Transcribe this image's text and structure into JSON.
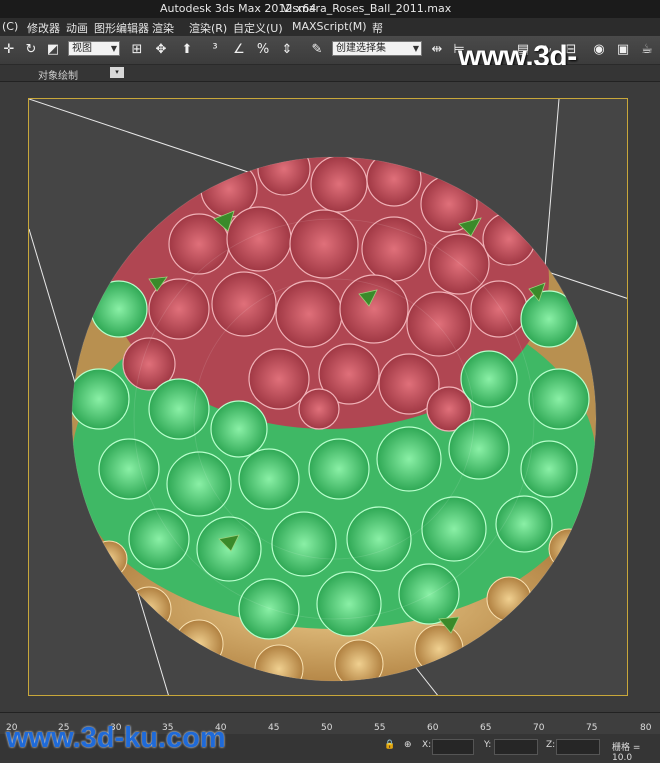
{
  "window": {
    "app_title": "Autodesk 3ds Max  2012 x64",
    "file_name": "Vismara_Roses_Ball_2011.max"
  },
  "menu": [
    "(C)",
    "修改器",
    "动画",
    "图形编辑器",
    "渲染",
    "渲染(R)",
    "自定义(U)",
    "MAXScript(M)",
    "帮"
  ],
  "toolbar": {
    "view_dropdown": "视图",
    "selection_set_dropdown": "创建选择集",
    "icons": [
      "rotate-icon",
      "scale-icon",
      "move-icon",
      "snap-icon",
      "percent-snap-icon",
      "mirror-icon",
      "align-icon",
      "render-icon",
      "teapot-icon"
    ]
  },
  "ribbon": {
    "label": "对象绘制"
  },
  "watermark": "www.3d-ku.com",
  "timeline": {
    "ticks": [
      "20",
      "25",
      "30",
      "35",
      "40",
      "45",
      "50",
      "55",
      "60",
      "65",
      "70",
      "75",
      "80"
    ]
  },
  "status": {
    "x_label": "X:",
    "y_label": "Y:",
    "z_label": "Z:",
    "grid_label": "栅格 = 10.0"
  },
  "colors": {
    "viewport_border": "#c8a73a",
    "rose_red": "#c24a55",
    "rose_green": "#55d47a",
    "rose_yellow": "#d6b05a"
  }
}
